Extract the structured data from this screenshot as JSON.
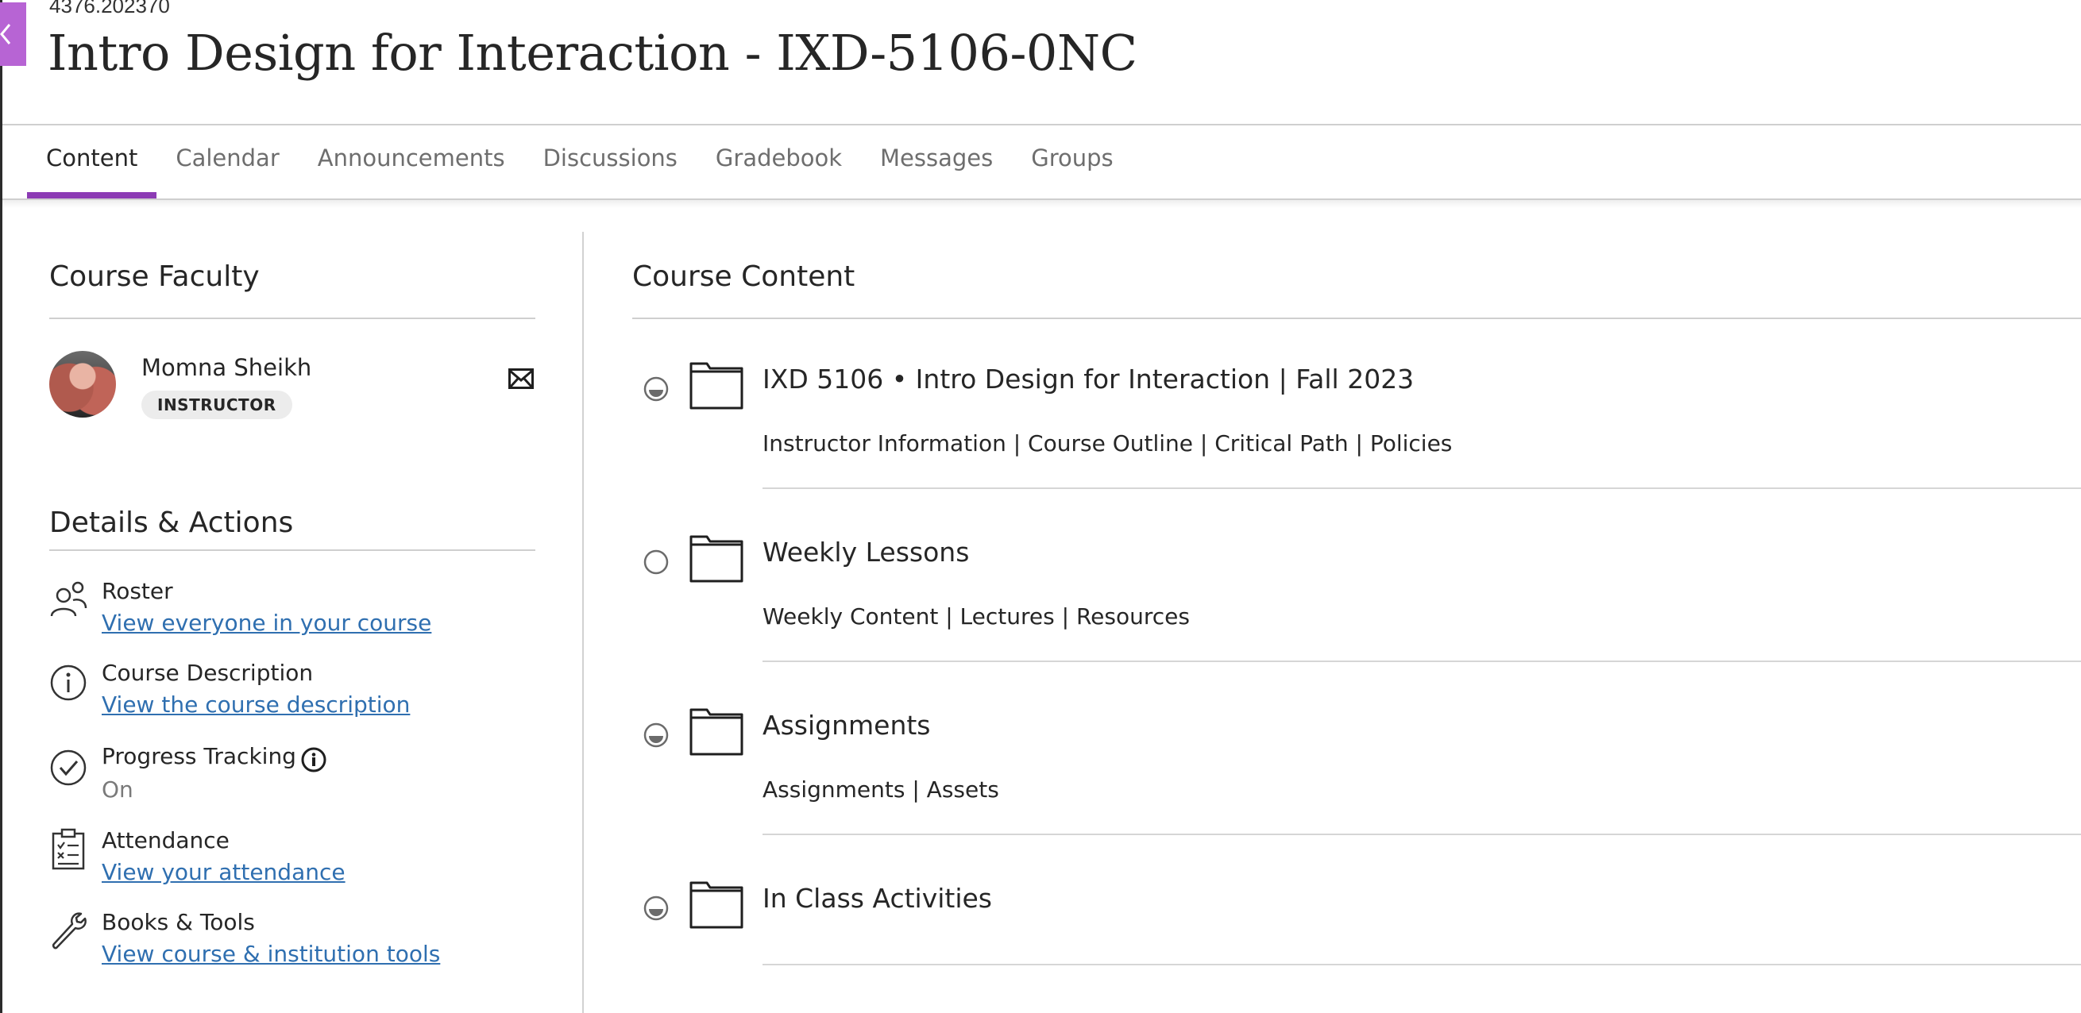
{
  "header": {
    "course_id": "4376.202370",
    "course_title": "Intro Design for Interaction - IXD-5106-0NC"
  },
  "tabs": [
    {
      "label": "Content",
      "active": true
    },
    {
      "label": "Calendar",
      "active": false
    },
    {
      "label": "Announcements",
      "active": false
    },
    {
      "label": "Discussions",
      "active": false
    },
    {
      "label": "Gradebook",
      "active": false
    },
    {
      "label": "Messages",
      "active": false
    },
    {
      "label": "Groups",
      "active": false
    }
  ],
  "faculty": {
    "title": "Course Faculty",
    "name": "Momna Sheikh",
    "role": "INSTRUCTOR",
    "contact_icon": "envelope-icon"
  },
  "details": {
    "title": "Details & Actions",
    "items": [
      {
        "label": "Roster",
        "link": "View everyone in your course",
        "icon": "roster-icon"
      },
      {
        "label": "Course Description",
        "link": "View the course description",
        "icon": "info-circle-icon"
      },
      {
        "label": "Progress Tracking",
        "value": "On",
        "icon": "check-circle-icon"
      },
      {
        "label": "Attendance",
        "link": "View your attendance",
        "icon": "clipboard-icon"
      },
      {
        "label": "Books & Tools",
        "link": "View course & institution tools",
        "icon": "wrench-icon"
      }
    ]
  },
  "content": {
    "title": "Course Content",
    "items": [
      {
        "title": "IXD 5106 • Intro Design for Interaction | Fall 2023",
        "description": "Instructor Information | Course Outline | Critical Path | Policies",
        "status": "half"
      },
      {
        "title": "Weekly Lessons",
        "description": "Weekly Content | Lectures | Resources",
        "status": "empty"
      },
      {
        "title": "Assignments",
        "description": "Assignments | Assets",
        "status": "half"
      },
      {
        "title": "In Class Activities",
        "description": "",
        "status": "half"
      }
    ]
  },
  "colors": {
    "accent": "#8c3bb4",
    "close_tab": "#b764d4",
    "link": "#2f6fb0"
  }
}
